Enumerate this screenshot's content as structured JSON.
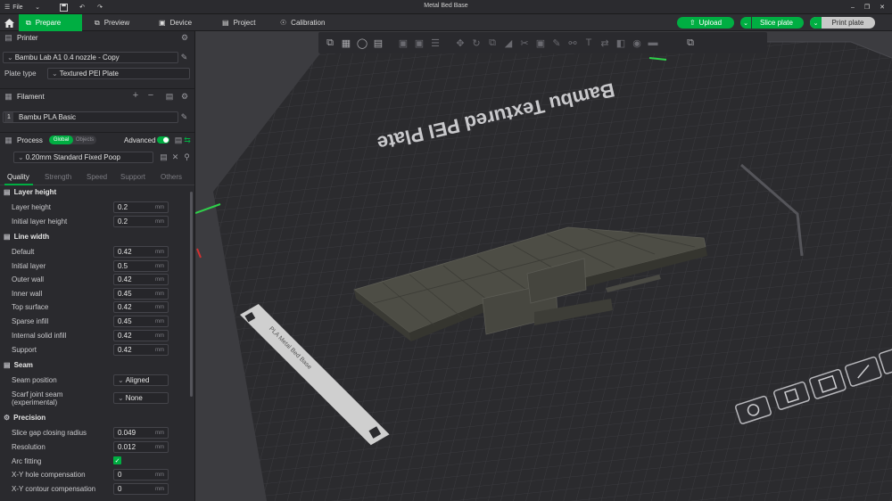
{
  "titlebar": {
    "menu_label": "File",
    "window_title": "Metal Bed Base"
  },
  "nav": {
    "tabs": [
      "Prepare",
      "Preview",
      "Device",
      "Project",
      "Calibration"
    ],
    "active_tab": "Prepare",
    "upload_label": "Upload",
    "slice_label": "Slice plate",
    "print_label": "Print plate"
  },
  "colors": {
    "accent": "#00ae42",
    "sidebar_bg": "#2a2a2e",
    "viewport_bg": "#3c3c40",
    "plate": "#2b2b2e",
    "model": "#4d4d45"
  },
  "printer": {
    "header": "Printer",
    "name": "Bambu Lab A1 0.4 nozzle - Copy",
    "plate_type_label": "Plate type",
    "plate_type_value": "Textured PEI Plate"
  },
  "filament": {
    "header": "Filament",
    "slot_number": "1",
    "name": "Bambu PLA Basic"
  },
  "process": {
    "header": "Process",
    "toggle_global": "Global",
    "toggle_objects": "Objects",
    "advanced_label": "Advanced",
    "advanced_on": true,
    "preset": "0.20mm Standard Fixed Poop"
  },
  "tabs": [
    "Quality",
    "Strength",
    "Speed",
    "Support",
    "Others"
  ],
  "settings": {
    "layer_height": {
      "title": "Layer height",
      "rows": [
        {
          "label": "Layer height",
          "value": "0.2",
          "unit": "mm"
        },
        {
          "label": "Initial layer height",
          "value": "0.2",
          "unit": "mm"
        }
      ]
    },
    "line_width": {
      "title": "Line width",
      "rows": [
        {
          "label": "Default",
          "value": "0.42",
          "unit": "mm"
        },
        {
          "label": "Initial layer",
          "value": "0.5",
          "unit": "mm"
        },
        {
          "label": "Outer wall",
          "value": "0.42",
          "unit": "mm"
        },
        {
          "label": "Inner wall",
          "value": "0.45",
          "unit": "mm"
        },
        {
          "label": "Top surface",
          "value": "0.42",
          "unit": "mm"
        },
        {
          "label": "Sparse infill",
          "value": "0.45",
          "unit": "mm"
        },
        {
          "label": "Internal solid infill",
          "value": "0.42",
          "unit": "mm"
        },
        {
          "label": "Support",
          "value": "0.42",
          "unit": "mm"
        }
      ]
    },
    "seam": {
      "title": "Seam",
      "seam_position_label": "Seam position",
      "seam_position_value": "Aligned",
      "scarf_label_1": "Scarf joint seam",
      "scarf_label_2": "(experimental)",
      "scarf_value": "None"
    },
    "precision": {
      "title": "Precision",
      "slice_gap_label": "Slice gap closing radius",
      "slice_gap_value": "0.049",
      "resolution_label": "Resolution",
      "resolution_value": "0.012",
      "arc_fitting_label": "Arc fitting",
      "arc_fitting_checked": true,
      "xy_hole_label": "X-Y hole compensation",
      "xy_hole_value": "0",
      "xy_contour_label": "X-Y contour compensation",
      "xy_contour_value": "0",
      "unit": "mm"
    }
  },
  "viewport": {
    "plate_label": "Bambu Textured PEI Plate",
    "plate_tab_text": "PLA Metal Bed Base"
  }
}
